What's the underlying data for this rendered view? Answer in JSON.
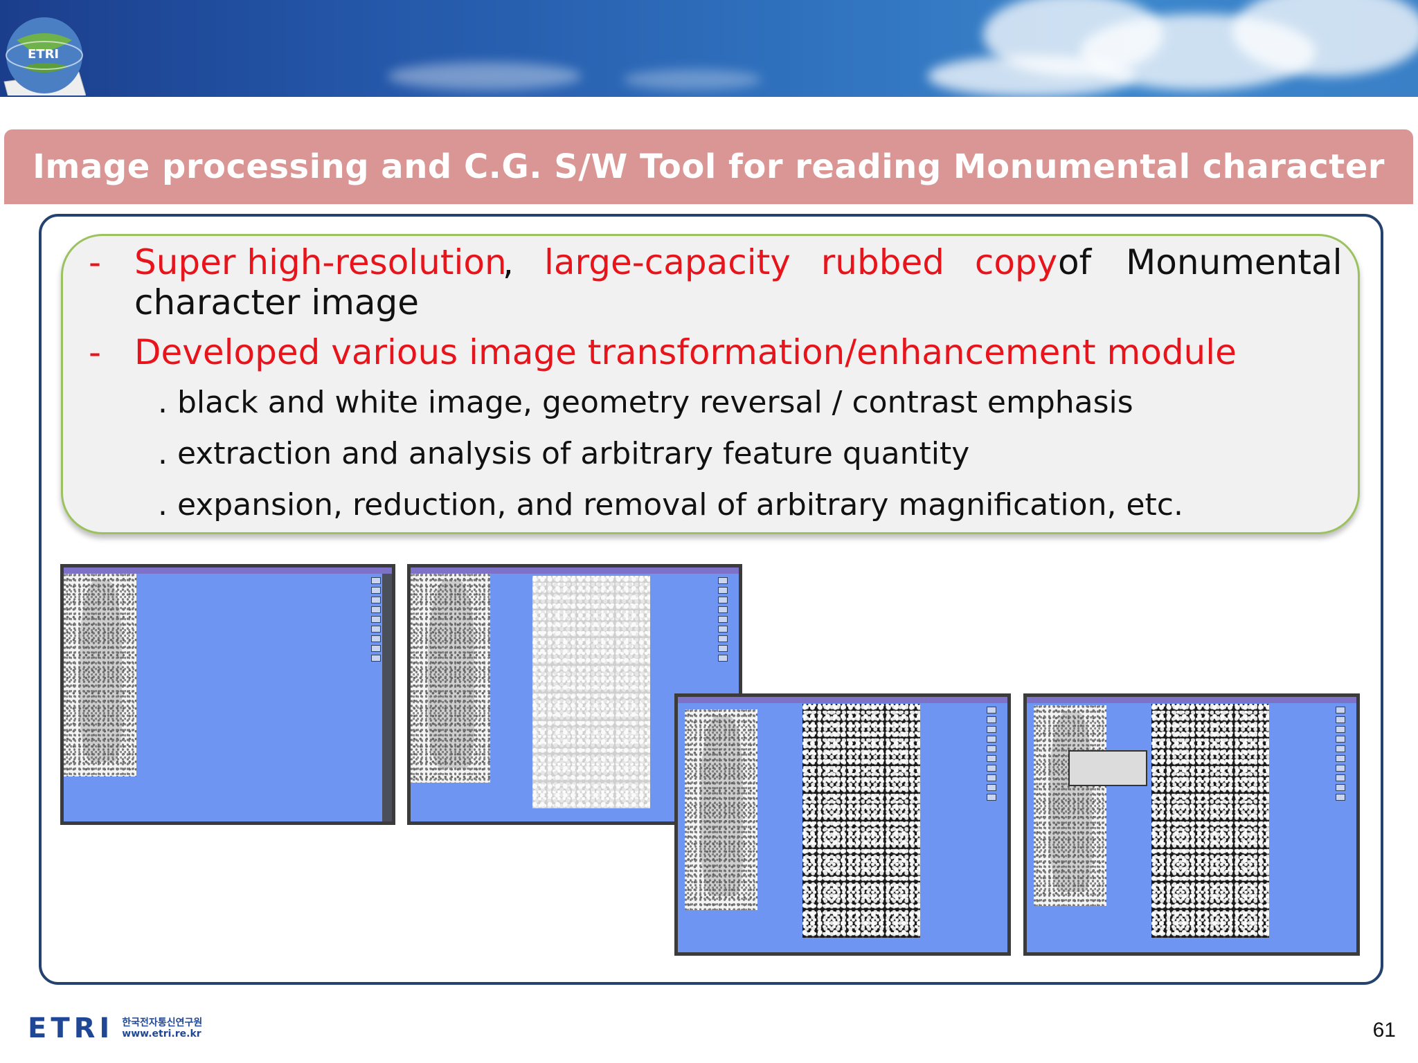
{
  "header": {
    "logo_text": "ETRI",
    "title": "Image processing and C.G. S/W Tool for reading Monumental character"
  },
  "bullets": [
    {
      "dash": "-",
      "parts": [
        {
          "text": "Super high-resolution",
          "color": "red"
        },
        {
          "text": ",",
          "color": "black"
        },
        {
          "text": "large-capacity rubbed copy",
          "color": "red"
        },
        {
          "text": "of Monumental",
          "color": "black"
        }
      ],
      "continuation": "character image"
    },
    {
      "dash": "-",
      "text": "Developed various image transformation/enhancement module"
    }
  ],
  "sub_items": [
    ". black and white image, geometry reversal / contrast emphasis",
    ". extraction and analysis of arbitrary feature quantity",
    ". expansion, reduction, and removal of arbitrary magnification, etc."
  ],
  "screenshots": [
    {
      "name": "screenshot-original"
    },
    {
      "name": "screenshot-zoomed"
    },
    {
      "name": "screenshot-enhanced"
    },
    {
      "name": "screenshot-character-reading"
    }
  ],
  "footer": {
    "logo_word": "ETRI",
    "org_name_korean": "한국전자통신연구원",
    "url": "www.etri.re.kr",
    "page_number": "61"
  },
  "colors": {
    "title_bar": "#d99694",
    "highlight": "#e8141c",
    "frame": "#24426f",
    "text_box_border": "#9cc25f"
  }
}
